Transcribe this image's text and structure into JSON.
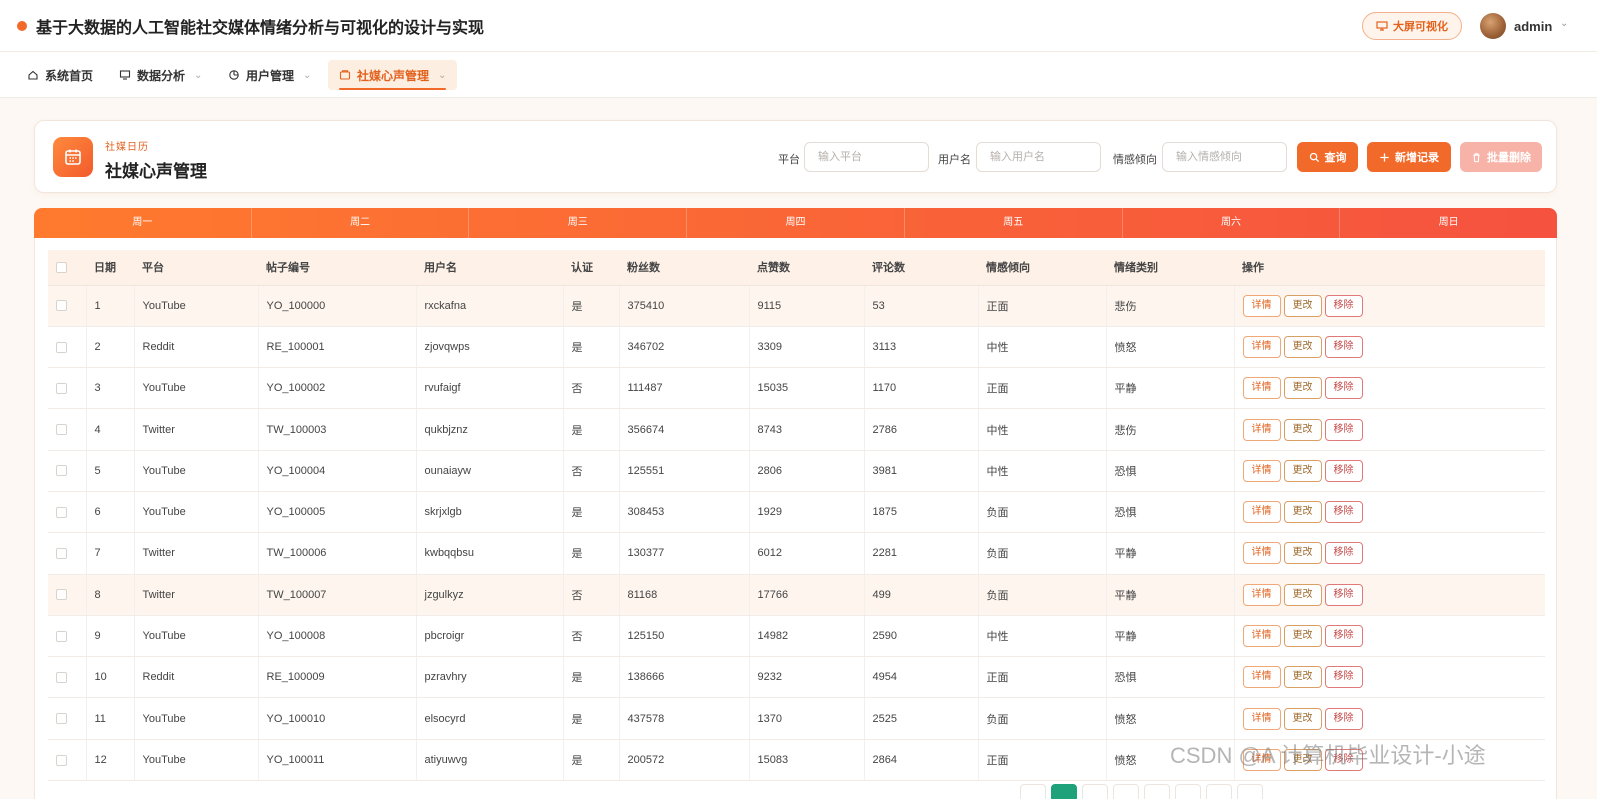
{
  "header": {
    "app_title": "基于大数据的人工智能社交媒体情绪分析与可视化的设计与实现",
    "bigscreen_label": "大屏可视化",
    "user_name": "admin"
  },
  "nav": [
    {
      "label": "系统首页",
      "icon": "home-icon"
    },
    {
      "label": "数据分析",
      "icon": "monitor-icon"
    },
    {
      "label": "用户管理",
      "icon": "pie-icon"
    },
    {
      "label": "社媒心声管理",
      "icon": "message-box-icon",
      "active": true
    }
  ],
  "card": {
    "subtitle": "社媒日历",
    "title": "社媒心声管理",
    "filters": [
      {
        "label": "平台",
        "placeholder": "输入平台"
      },
      {
        "label": "用户名",
        "placeholder": "输入用户名"
      },
      {
        "label": "情感倾向",
        "placeholder": "输入情感倾向"
      }
    ],
    "buttons": {
      "query": "查询",
      "add": "新增记录",
      "batch_delete": "批量删除"
    }
  },
  "weekdays": [
    "周一",
    "周二",
    "周三",
    "周四",
    "周五",
    "周六",
    "周日"
  ],
  "table": {
    "columns": [
      "日期",
      "平台",
      "帖子编号",
      "用户名",
      "认证",
      "粉丝数",
      "点赞数",
      "评论数",
      "情感倾向",
      "情绪类别",
      "操作"
    ],
    "actions": {
      "detail": "详情",
      "edit": "更改",
      "remove": "移除"
    },
    "rows": [
      [
        "1",
        "YouTube",
        "YO_100000",
        "rxckafna",
        "是",
        "375410",
        "9115",
        "53",
        "正面",
        "悲伤"
      ],
      [
        "2",
        "Reddit",
        "RE_100001",
        "zjovqwps",
        "是",
        "346702",
        "3309",
        "3113",
        "中性",
        "愤怒"
      ],
      [
        "3",
        "YouTube",
        "YO_100002",
        "rvufaigf",
        "否",
        "111487",
        "15035",
        "1170",
        "正面",
        "平静"
      ],
      [
        "4",
        "Twitter",
        "TW_100003",
        "qukbjznz",
        "是",
        "356674",
        "8743",
        "2786",
        "中性",
        "悲伤"
      ],
      [
        "5",
        "YouTube",
        "YO_100004",
        "ounaiayw",
        "否",
        "125551",
        "2806",
        "3981",
        "中性",
        "恐惧"
      ],
      [
        "6",
        "YouTube",
        "YO_100005",
        "skrjxlgb",
        "是",
        "308453",
        "1929",
        "1875",
        "负面",
        "恐惧"
      ],
      [
        "7",
        "Twitter",
        "TW_100006",
        "kwbqqbsu",
        "是",
        "130377",
        "6012",
        "2281",
        "负面",
        "平静"
      ],
      [
        "8",
        "Twitter",
        "TW_100007",
        "jzgulkyz",
        "否",
        "81168",
        "17766",
        "499",
        "负面",
        "平静"
      ],
      [
        "9",
        "YouTube",
        "YO_100008",
        "pbcroigr",
        "否",
        "125150",
        "14982",
        "2590",
        "中性",
        "平静"
      ],
      [
        "10",
        "Reddit",
        "RE_100009",
        "pzravhry",
        "是",
        "138666",
        "9232",
        "4954",
        "正面",
        "恐惧"
      ],
      [
        "11",
        "YouTube",
        "YO_100010",
        "elsocyrd",
        "是",
        "437578",
        "1370",
        "2525",
        "负面",
        "愤怒"
      ],
      [
        "12",
        "YouTube",
        "YO_100011",
        "atiyuwvg",
        "是",
        "200572",
        "15083",
        "2864",
        "正面",
        "愤怒"
      ]
    ]
  },
  "watermark": "CSDN @A 计算机毕业设计-小途"
}
